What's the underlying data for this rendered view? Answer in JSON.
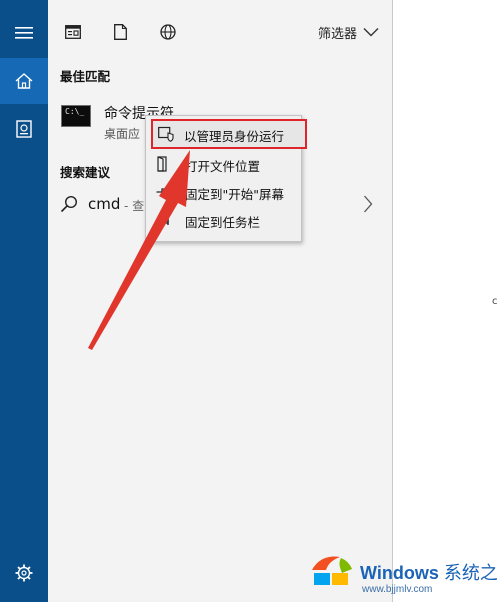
{
  "rail": {
    "items": [
      {
        "name": "menu-icon"
      },
      {
        "name": "home-icon",
        "active": true
      },
      {
        "name": "documents-icon"
      }
    ],
    "bottom": {
      "name": "settings-icon"
    }
  },
  "topbar": {
    "icons": [
      "apps-icon",
      "document-icon",
      "web-icon"
    ],
    "filter_label": "筛选器"
  },
  "best_match": {
    "heading": "最佳匹配",
    "title": "命令提示符",
    "subtitle": "桌面应",
    "icon_text": "C:\\_"
  },
  "search_suggestions": {
    "heading": "搜索建议",
    "query": "cmd",
    "query_suffix": "- 查"
  },
  "context_menu": {
    "items": [
      {
        "label": "以管理员身份运行",
        "icon": "shield-run-icon",
        "highlighted": true
      },
      {
        "label": "打开文件位置",
        "icon": "folder-open-icon"
      },
      {
        "label": "固定到\"开始\"屏幕",
        "icon": "pin-icon"
      },
      {
        "label": "固定到任务栏",
        "icon": "pin-taskbar-icon"
      }
    ]
  },
  "annotation": {
    "color": "#e0362c"
  },
  "colors": {
    "rail": "#0b4f8a",
    "rail_active": "#1669b5",
    "panel": "#f3f3f3",
    "highlight_border": "#e0252a"
  },
  "watermark": {
    "brand": "Windows",
    "brand_cn": "系统之家",
    "url": "www.bjjmlv.com"
  }
}
